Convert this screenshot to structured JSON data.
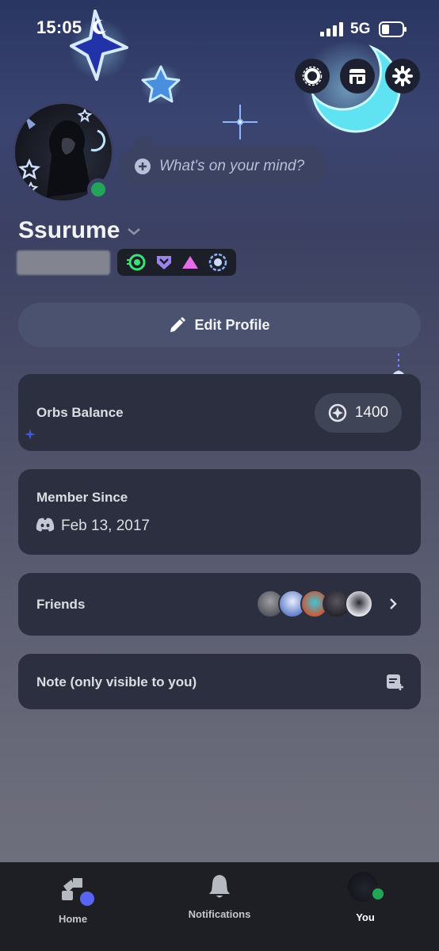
{
  "status_bar": {
    "time": "15:05",
    "network": "5G"
  },
  "header": {
    "buttons": [
      {
        "icon": "nitro-icon"
      },
      {
        "icon": "shop-icon"
      },
      {
        "icon": "gear-icon"
      }
    ]
  },
  "profile": {
    "status_placeholder": "What's on your mind?",
    "username": "Ssurume",
    "edit_label": "Edit Profile"
  },
  "orbs": {
    "label": "Orbs Balance",
    "value": "1400"
  },
  "member_since": {
    "label": "Member Since",
    "date": "Feb 13, 2017"
  },
  "friends": {
    "label": "Friends"
  },
  "note": {
    "label": "Note (only visible to you)"
  },
  "bottom_nav": {
    "home": "Home",
    "notifications": "Notifications",
    "you": "You"
  },
  "colors": {
    "online": "#23a559",
    "card": "#2b2f40",
    "accent": "#5865f2"
  }
}
